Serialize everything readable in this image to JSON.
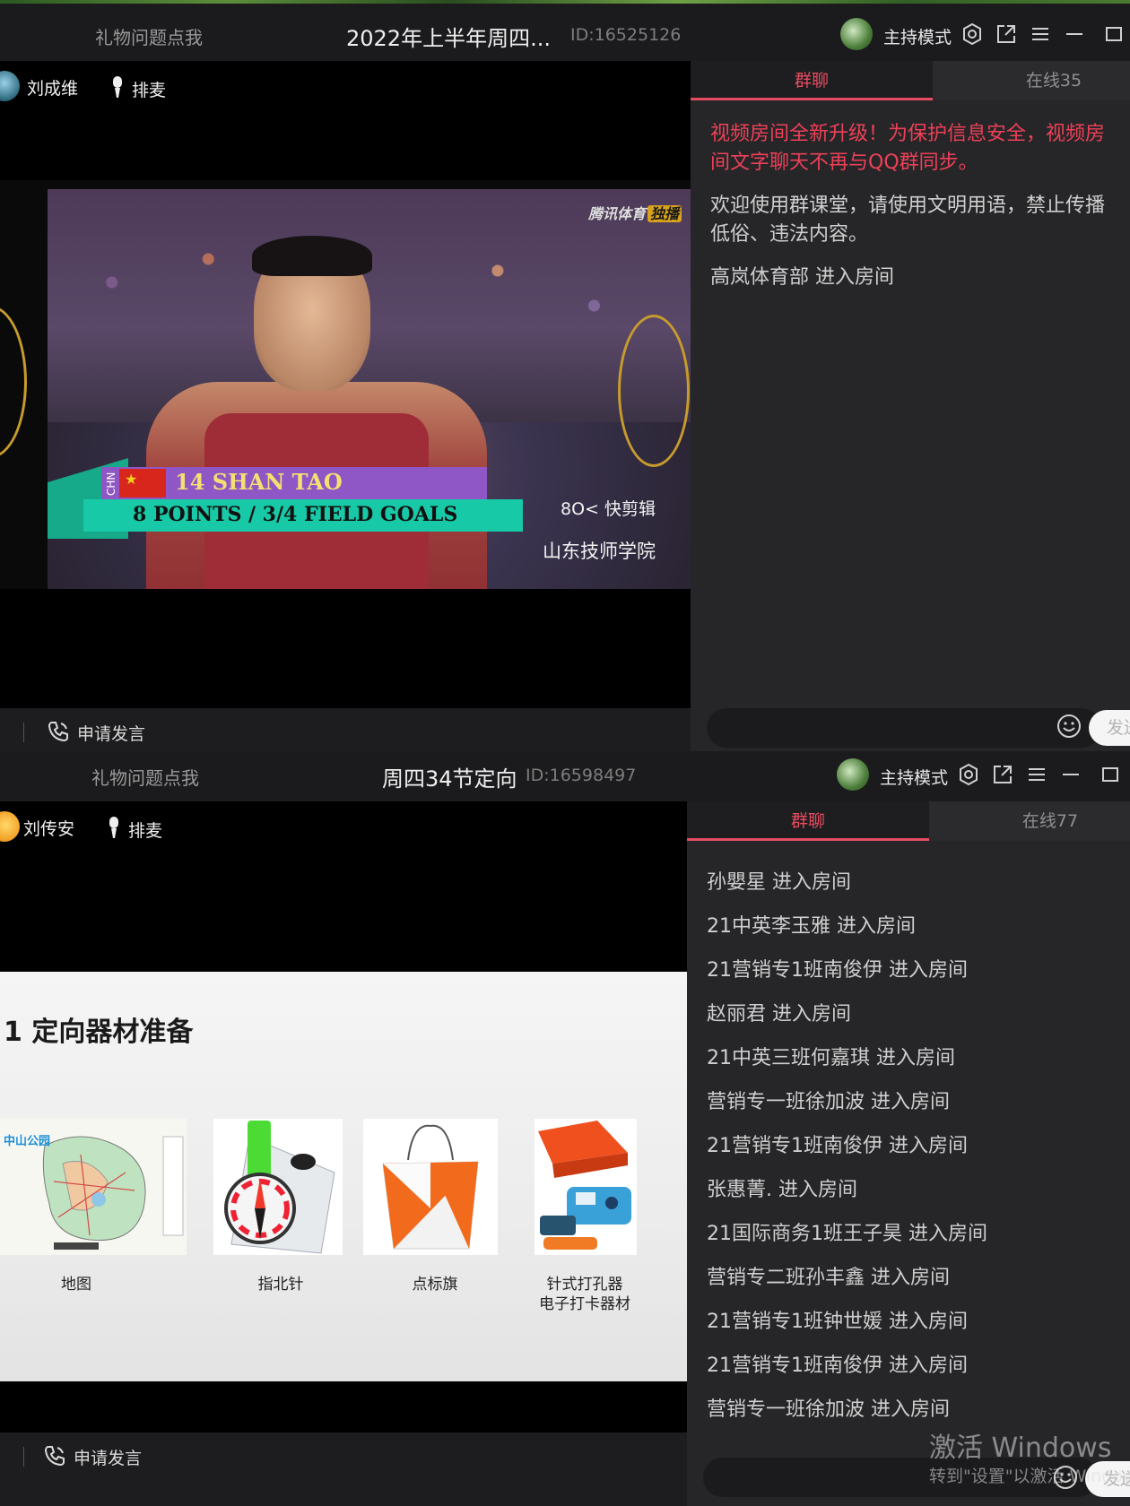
{
  "window_top": {
    "titlebar": {
      "gift_link": "礼物问题点我",
      "room_title": "2022年上半年周四...",
      "room_id": "ID:16525126",
      "host_mode": "主持模式"
    },
    "stage": {
      "host_name": "刘成维",
      "queue_label": "排麦"
    },
    "video": {
      "broadcaster": "腾讯体育",
      "broadcaster_tag": "独播",
      "country_code": "CHN",
      "player_line": "14 SHAN TAO",
      "stats_line": "8 POINTS / 3/4 FIELD GOALS",
      "editor_watermark": "8O< 快剪辑",
      "school_watermark": "山东技师学院"
    },
    "bottombar": {
      "apply_speak": "申请发言"
    },
    "chat": {
      "tab_group": "群聊",
      "tab_online": "在线35",
      "system_notice": [
        "视频房间全新升级！为保护信息安全，视频房",
        "间文字聊天不再与QQ群同步。"
      ],
      "welcome": [
        "欢迎使用群课堂，请使用文明用语，禁止传播",
        "低俗、违法内容。"
      ],
      "messages": [
        "高岚体育部 进入房间"
      ],
      "send_label": "发送"
    }
  },
  "window_bottom": {
    "titlebar": {
      "gift_link": "礼物问题点我",
      "room_title": "周四34节定向",
      "room_id": "ID:16598497",
      "host_mode": "主持模式"
    },
    "stage": {
      "host_name": "刘传安",
      "queue_label": "排麦"
    },
    "slide": {
      "title": "1  定向器材准备",
      "items": [
        {
          "caption": "地图",
          "map_label": "中山公园"
        },
        {
          "caption": "指北针"
        },
        {
          "caption": "点标旗"
        },
        {
          "caption_line1": "针式打孔器",
          "caption_line2": "电子打卡器材"
        }
      ]
    },
    "bottombar": {
      "apply_speak": "申请发言"
    },
    "chat": {
      "tab_group": "群聊",
      "tab_online": "在线77",
      "messages": [
        "孙嬰星 进入房间",
        "21中英李玉雅 进入房间",
        "21营销专1班南俊伊 进入房间",
        "赵丽君 进入房间",
        "21中英三班何嘉琪 进入房间",
        "营销专一班徐加波 进入房间",
        "21营销专1班南俊伊 进入房间",
        "张惠菁. 进入房间",
        "21国际商务1班王子昊 进入房间",
        "营销专二班孙丰鑫 进入房间",
        "21营销专1班钟世媛 进入房间",
        "21营销专1班南俊伊 进入房间",
        "营销专一班徐加波 进入房间"
      ],
      "send_label": "发送"
    }
  },
  "os_overlay": {
    "activate_title": "激活 Windows",
    "activate_sub": "转到\"设置\"以激活 Windows。"
  },
  "colors": {
    "accent": "#e84c62",
    "system_notice": "#ee4057",
    "panel_bg": "#262628",
    "titlebar_bg": "#1b1b1d"
  }
}
